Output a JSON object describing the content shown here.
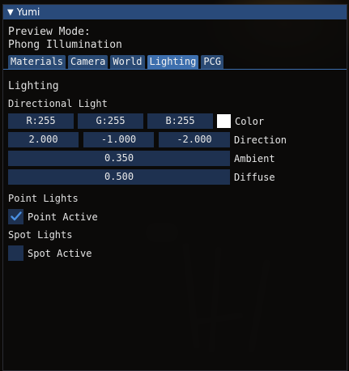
{
  "window": {
    "title": "Yumi",
    "preview_mode_label": "Preview Mode:",
    "preview_mode_value": "Phong Illumination"
  },
  "tabs": [
    {
      "label": "Materials",
      "active": false
    },
    {
      "label": "Camera",
      "active": false
    },
    {
      "label": "World",
      "active": false
    },
    {
      "label": "Lighting",
      "active": true
    },
    {
      "label": "PCG",
      "active": false
    }
  ],
  "lighting": {
    "section_title": "Lighting",
    "directional": {
      "title": "Directional Light",
      "color_r": "R:255",
      "color_g": "G:255",
      "color_b": "B:255",
      "color_hex": "#ffffff",
      "color_label": "Color",
      "dir_x": "2.000",
      "dir_y": "-1.000",
      "dir_z": "-2.000",
      "direction_label": "Direction",
      "ambient": "0.350",
      "ambient_label": "Ambient",
      "diffuse": "0.500",
      "diffuse_label": "Diffuse"
    },
    "point": {
      "title": "Point Lights",
      "checkbox_label": "Point Active",
      "checked": true
    },
    "spot": {
      "title": "Spot Lights",
      "checkbox_label": "Spot Active",
      "checked": false
    }
  },
  "colors": {
    "title_bar": "#294a7a",
    "tab": "#2a4a74",
    "tab_active": "#3d6fae",
    "frame": "#1e3150",
    "check_mark": "#4a90e2"
  }
}
